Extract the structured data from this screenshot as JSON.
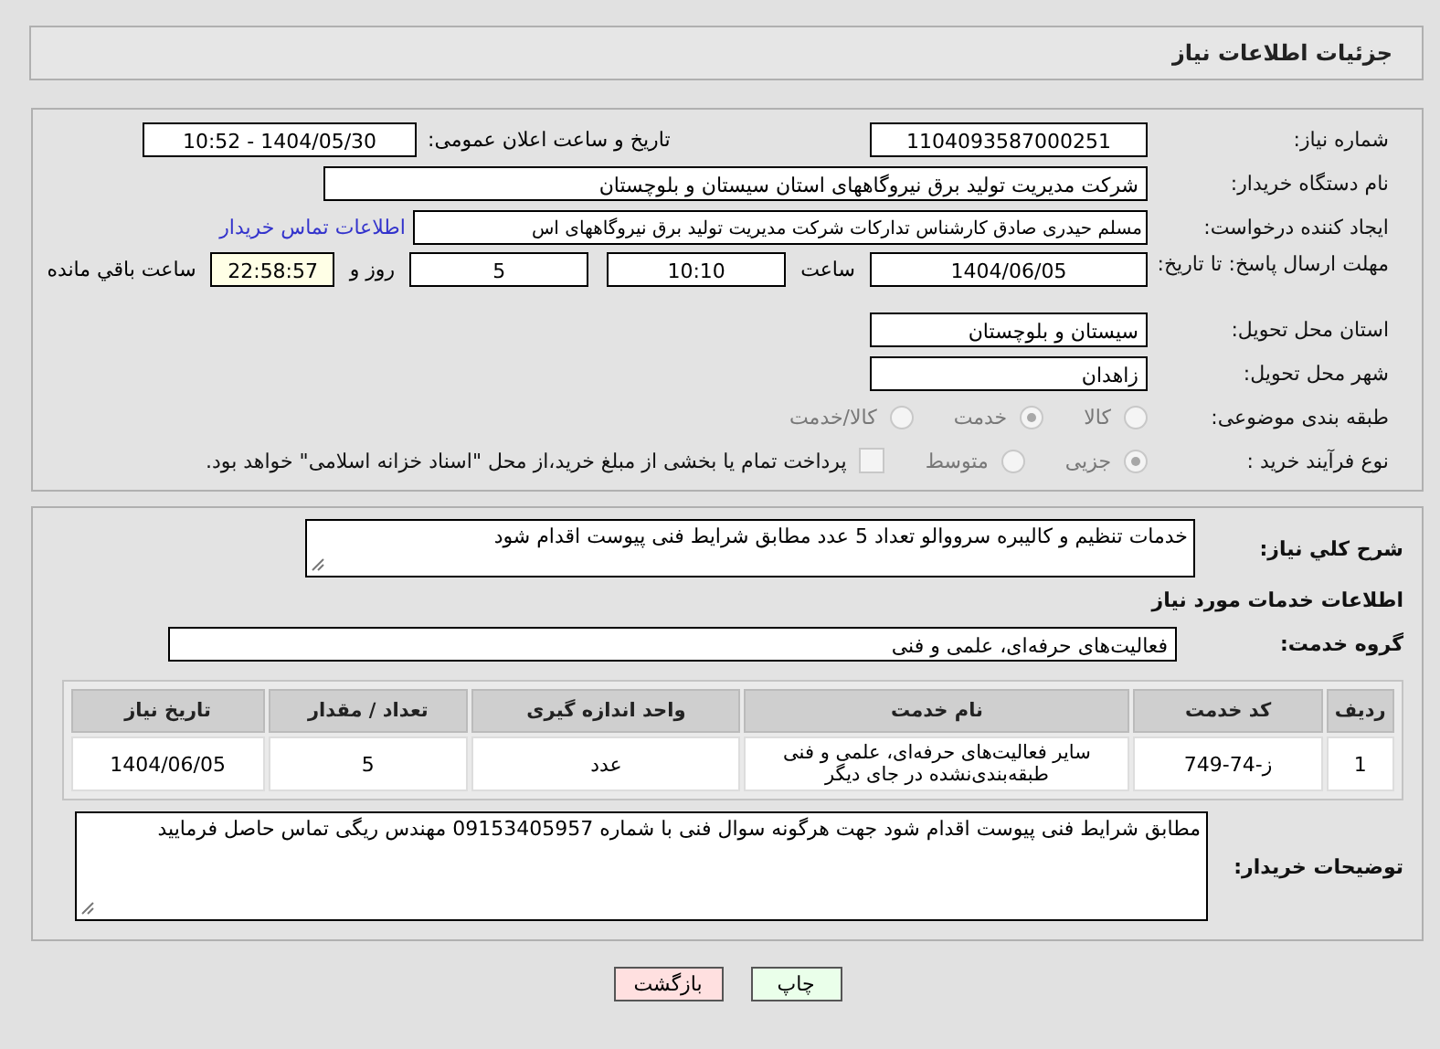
{
  "header": {
    "title": "جزئیات اطلاعات نیاز"
  },
  "need_number": {
    "label": "شماره نیاز:",
    "value": "1104093587000251"
  },
  "announce": {
    "label": "تاریخ و ساعت اعلان عمومی:",
    "value": "1404/05/30 - 10:52"
  },
  "buyer": {
    "label": "نام دستگاه خریدار:",
    "value": "شرکت مدیریت تولید برق نیروگاههای استان سیستان و بلوچستان"
  },
  "creator": {
    "label": "ایجاد کننده درخواست:",
    "value": "مسلم حیدری صادق کارشناس تدارکات شرکت مدیریت تولید برق نیروگاههای اس",
    "link": "اطلاعات تماس خریدار"
  },
  "deadline": {
    "label": "مهلت ارسال پاسخ: تا تاریخ:",
    "date": "1404/06/05",
    "time_label": "ساعت",
    "time": "10:10",
    "days": "5",
    "days_label": "روز و",
    "remaining": "22:58:57",
    "remaining_label": "ساعت باقي مانده"
  },
  "province": {
    "label": "استان محل تحویل:",
    "value": "سیستان و بلوچستان"
  },
  "city": {
    "label": "شهر محل تحویل:",
    "value": "زاهدان"
  },
  "category": {
    "label": "طبقه بندی موضوعی:",
    "options": [
      {
        "label": "کالا",
        "selected": false
      },
      {
        "label": "خدمت",
        "selected": true
      },
      {
        "label": "کالا/خدمت",
        "selected": false
      }
    ]
  },
  "process": {
    "label": "نوع فرآیند خرید :",
    "options": [
      {
        "label": "جزیی",
        "selected": true
      },
      {
        "label": "متوسط",
        "selected": false
      }
    ],
    "treasury": {
      "label": "پرداخت تمام یا بخشی از مبلغ خرید،از محل \"اسناد خزانه اسلامی\" خواهد بود.",
      "checked": false
    }
  },
  "description": {
    "label": "شرح کلي نیاز:",
    "value": "خدمات تنظیم و کالیبره سرووالو تعداد  5 عدد  مطابق شرایط فنی پیوست اقدام شود"
  },
  "services_heading": "اطلاعات خدمات مورد نیاز",
  "service_group": {
    "label": "گروه خدمت:",
    "value": "فعالیت‌های حرفه‌ای، علمی و فنی"
  },
  "table": {
    "columns": [
      "ردیف",
      "کد خدمت",
      "نام خدمت",
      "واحد اندازه گیری",
      "تعداد / مقدار",
      "تاریخ نیاز"
    ],
    "rows": [
      [
        "1",
        "ز-74-749",
        "سایر فعالیت‌های حرفه‌ای، علمی و فنی طبقه‌بندی‌نشده در جای دیگر",
        "عدد",
        "5",
        "1404/06/05"
      ]
    ]
  },
  "buyer_notes": {
    "label": "توضیحات خریدار:",
    "value": "مطابق شرایط فنی پیوست اقدام شود جهت هرگونه سوال فنی با شماره 09153405957 مهندس ریگی تماس حاصل فرمایید"
  },
  "buttons": [
    {
      "label": "چاپ",
      "kind": "print"
    },
    {
      "label": "بازگشت",
      "kind": "back"
    }
  ]
}
